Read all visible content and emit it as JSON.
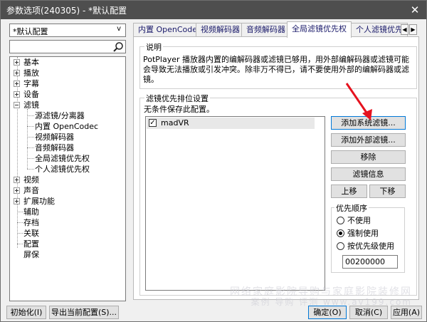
{
  "window": {
    "title": "参数选项(240305) - *默认配置",
    "close_glyph": "✕"
  },
  "profile_dropdown": {
    "value": "*默认配置",
    "arrow": "v"
  },
  "tree": {
    "items": [
      {
        "label": "基本",
        "expander": "plus"
      },
      {
        "label": "播放",
        "expander": "plus"
      },
      {
        "label": "字幕",
        "expander": "plus"
      },
      {
        "label": "设备",
        "expander": "plus"
      },
      {
        "label": "滤镜",
        "expander": "minus"
      },
      {
        "label": "源滤镜/分离器",
        "child": true
      },
      {
        "label": "内置 OpenCodec",
        "child": true
      },
      {
        "label": "视频解码器",
        "child": true
      },
      {
        "label": "音频解码器",
        "child": true
      },
      {
        "label": "全局滤镜优先权",
        "child": true
      },
      {
        "label": "个人滤镜优先权",
        "child": true
      },
      {
        "label": "视频",
        "expander": "plus"
      },
      {
        "label": "声音",
        "expander": "plus"
      },
      {
        "label": "扩展功能",
        "expander": "plus"
      },
      {
        "label": "辅助"
      },
      {
        "label": "存档"
      },
      {
        "label": "关联"
      },
      {
        "label": "配置"
      },
      {
        "label": "屏保"
      }
    ]
  },
  "tabs": [
    {
      "label": "内置 OpenCodec"
    },
    {
      "label": "视频解码器"
    },
    {
      "label": "音频解码器"
    },
    {
      "label": "全局滤镜优先权",
      "active": true
    },
    {
      "label": "个人滤镜优先"
    }
  ],
  "tab_scroll": {
    "left": "◀",
    "right": "▶"
  },
  "description": {
    "title": "说明",
    "text": "PotPlayer 播放器内置的编解码器或滤镜已够用，用外部编解码器或滤镜可能会导致无法播放或引发冲突。除非万不得已，请不要使用外部的编解码器或滤镜。"
  },
  "priority": {
    "title": "滤镜优先排位设置",
    "condition": "无条件保存此配置。",
    "filters": [
      {
        "name": "madVR",
        "checked": true
      }
    ],
    "check_glyph": "✓"
  },
  "buttons": {
    "add_system": "添加系统滤镜...",
    "add_external": "添加外部滤镜...",
    "remove": "移除",
    "filter_info": "滤镜信息",
    "move_up": "上移",
    "move_down": "下移"
  },
  "order": {
    "title": "优先顺序",
    "options": [
      {
        "label": "不使用",
        "selected": false
      },
      {
        "label": "强制使用",
        "selected": true
      },
      {
        "label": "按优先级使用",
        "selected": false
      }
    ],
    "value": "00200000"
  },
  "footer": {
    "init": "初始化(I)",
    "export": "导出当前配置(S)...",
    "ok": "确定(O)",
    "cancel": "取消(C)",
    "apply": "应用(A)"
  },
  "watermark": {
    "line1": "网络家庭影院导购与家庭影院装修网",
    "line2": "案例 导购 评测 www.av199.com"
  },
  "colors": {
    "titlebar": "#4e4e4e",
    "focus": "#0078d7",
    "arrow": "#e5121e"
  }
}
